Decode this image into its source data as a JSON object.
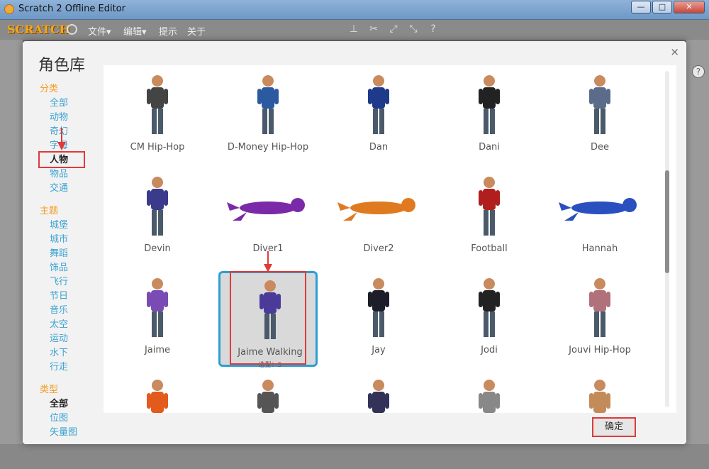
{
  "window": {
    "title": "Scratch 2 Offline Editor",
    "buttons": [
      "—",
      "□",
      "✕"
    ]
  },
  "menubar": {
    "logo": "SCRATCH",
    "items": [
      "文件▾",
      "编辑▾",
      "提示",
      "关于"
    ]
  },
  "dialog": {
    "title": "角色库",
    "close": "×",
    "categories": {
      "head": "分类",
      "items": [
        "全部",
        "动物",
        "奇幻",
        "字母",
        "人物",
        "物品",
        "交通"
      ],
      "active_index": 4
    },
    "themes": {
      "head": "主题",
      "items": [
        "城堡",
        "城市",
        "舞蹈",
        "饰品",
        "飞行",
        "节日",
        "音乐",
        "太空",
        "运动",
        "水下",
        "行走"
      ]
    },
    "types": {
      "head": "类型",
      "items": [
        "全部",
        "位图",
        "矢量图"
      ],
      "active_index": 0
    },
    "sprites": [
      {
        "name": "CM Hip-Hop",
        "color": "#444"
      },
      {
        "name": "D-Money Hip-Hop",
        "color": "#2b5aa0"
      },
      {
        "name": "Dan",
        "color": "#1d3b8a"
      },
      {
        "name": "Dani",
        "color": "#222"
      },
      {
        "name": "Dee",
        "color": "#5a6c8a"
      },
      {
        "name": "Devin",
        "color": "#3b3b8c"
      },
      {
        "name": "Diver1",
        "color": "#7a2aa8"
      },
      {
        "name": "Diver2",
        "color": "#e07a20"
      },
      {
        "name": "Football",
        "color": "#b01e1e"
      },
      {
        "name": "Hannah",
        "color": "#2a4fbf"
      },
      {
        "name": "Jaime",
        "color": "#7b4bb5"
      },
      {
        "name": "Jaime Walking",
        "color": "#4a3a9a",
        "sub": "造型：5",
        "selected": true
      },
      {
        "name": "Jay",
        "color": "#1e1e2a"
      },
      {
        "name": "Jodi",
        "color": "#222"
      },
      {
        "name": "Jouvi Hip-Hop",
        "color": "#b0717a"
      },
      {
        "name": "",
        "color": "#e25a1c"
      },
      {
        "name": "",
        "color": "#555"
      },
      {
        "name": "",
        "color": "#33335a"
      },
      {
        "name": "",
        "color": "#888"
      },
      {
        "name": "",
        "color": "#c48b5a"
      }
    ],
    "ok_button": "确定"
  }
}
